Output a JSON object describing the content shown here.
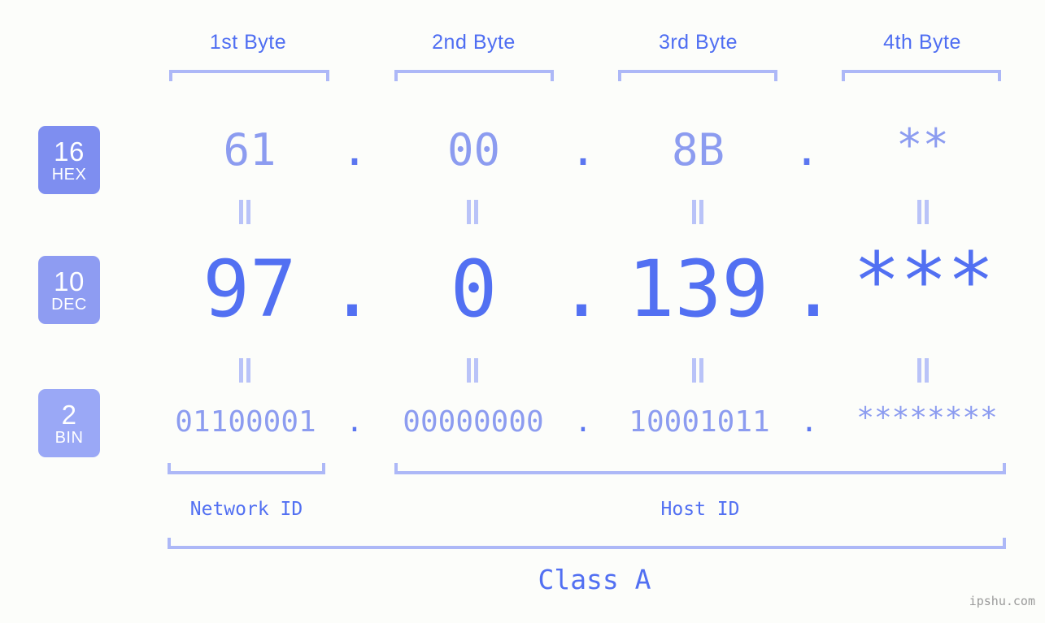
{
  "meta": {
    "watermark": "ipshu.com",
    "background_color": "#fcfdfa",
    "accent_strong": "#5270f2",
    "accent_light": "#8c9cf0",
    "accent_bracket": "#adb8f7"
  },
  "byte_headers": [
    {
      "label": "1st Byte"
    },
    {
      "label": "2nd Byte"
    },
    {
      "label": "3rd Byte"
    },
    {
      "label": "4th Byte"
    }
  ],
  "bases": [
    {
      "number": "16",
      "abbr": "HEX",
      "color": "#7e8ef0"
    },
    {
      "number": "10",
      "abbr": "DEC",
      "color": "#8e9cf2"
    },
    {
      "number": "2",
      "abbr": "BIN",
      "color": "#9aa8f6"
    }
  ],
  "rows": {
    "hex": {
      "base_number": "16",
      "base_abbr": "HEX",
      "values": [
        "61",
        "00",
        "8B",
        "**"
      ],
      "separator": "."
    },
    "dec": {
      "base_number": "10",
      "base_abbr": "DEC",
      "values": [
        "97",
        "0",
        "139",
        "***"
      ],
      "separator": "."
    },
    "bin": {
      "base_number": "2",
      "base_abbr": "BIN",
      "values": [
        "01100001",
        "00000000",
        "10001011",
        "********"
      ],
      "separator": "."
    }
  },
  "id_sections": [
    {
      "label": "Network ID"
    },
    {
      "label": "Host ID"
    }
  ],
  "class": {
    "label": "Class A"
  }
}
